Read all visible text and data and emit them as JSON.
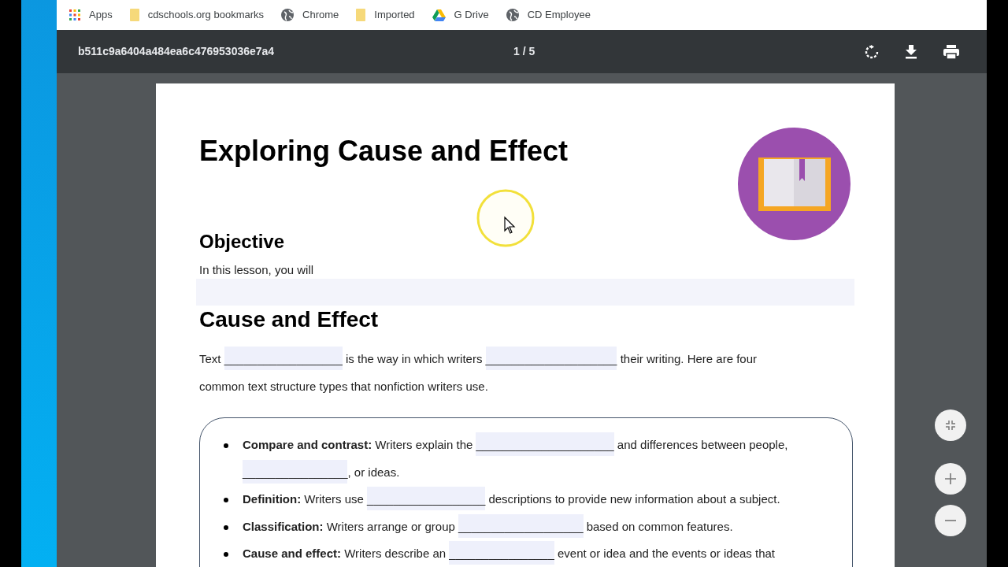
{
  "bookmarks": [
    {
      "label": "Apps",
      "kind": "apps"
    },
    {
      "label": "cdschools.org bookmarks",
      "kind": "folder"
    },
    {
      "label": "Chrome",
      "kind": "globe"
    },
    {
      "label": "Imported",
      "kind": "folder"
    },
    {
      "label": "G Drive",
      "kind": "drive"
    },
    {
      "label": "CD Employee",
      "kind": "globe"
    }
  ],
  "viewer": {
    "file_name": "b511c9a6404a484ea6c476953036e7a4",
    "page_indicator": "1 / 5"
  },
  "document": {
    "title": "Exploring Cause and Effect",
    "objective": {
      "heading": "Objective",
      "text": "In this lesson, you will"
    },
    "section": {
      "heading": "Cause and Effect",
      "paragraph": [
        [
          {
            "kind": "text",
            "text": "Text"
          },
          {
            "kind": "blank",
            "text": "__________________"
          },
          {
            "kind": "text",
            "text": "is the way in which writers"
          },
          {
            "kind": "blank",
            "text": "____________________"
          },
          {
            "kind": "text",
            "text": "their writing. Here are four"
          }
        ],
        [
          {
            "kind": "text",
            "text": "common text structure types that nonfiction writers use."
          }
        ]
      ],
      "structure_types": [
        {
          "lines": [
            [
              {
                "kind": "text",
                "text": "**Compare and contrast:** Writers explain the"
              },
              {
                "kind": "blank",
                "text": "_____________________"
              },
              {
                "kind": "text",
                "text": "and differences between people,"
              }
            ],
            [
              {
                "kind": "blank",
                "text": "________________"
              },
              {
                "kind": "text",
                "text": ", or ideas."
              }
            ]
          ]
        },
        {
          "lines": [
            [
              {
                "kind": "text",
                "text": "**Definition:** Writers use"
              },
              {
                "kind": "blank",
                "text": "__________________"
              },
              {
                "kind": "text",
                "text": "descriptions to provide new information about a subject."
              }
            ]
          ]
        },
        {
          "lines": [
            [
              {
                "kind": "text",
                "text": "**Classification:** Writers arrange or group"
              },
              {
                "kind": "blank",
                "text": "___________________"
              },
              {
                "kind": "text",
                "text": "based on common features."
              }
            ]
          ]
        },
        {
          "lines": [
            [
              {
                "kind": "text",
                "text": "**Cause and effect:** Writers describe an"
              },
              {
                "kind": "blank",
                "text": "________________"
              },
              {
                "kind": "text",
                "text": "event or idea and the events or ideas that"
              }
            ]
          ]
        }
      ]
    }
  }
}
